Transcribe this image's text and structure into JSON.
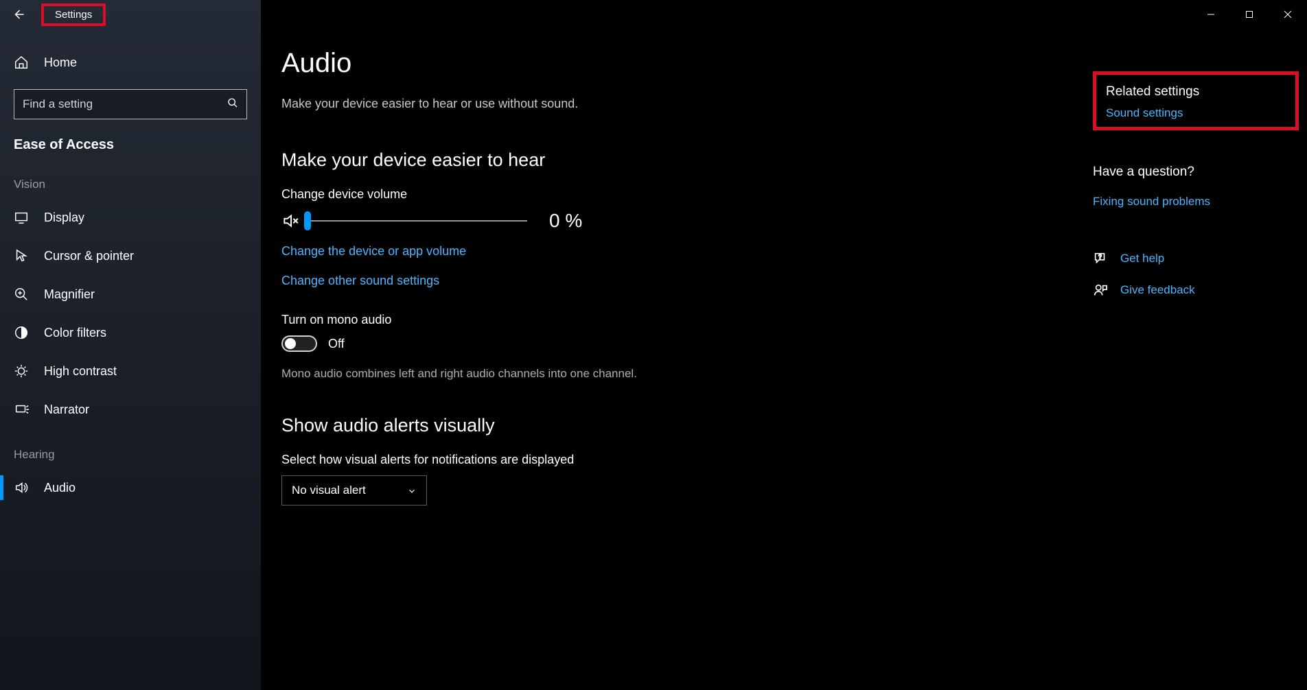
{
  "window": {
    "title": "Settings"
  },
  "sidebar": {
    "home": "Home",
    "search_placeholder": "Find a setting",
    "category": "Ease of Access",
    "groups": [
      {
        "label": "Vision",
        "items": [
          {
            "label": "Display"
          },
          {
            "label": "Cursor & pointer"
          },
          {
            "label": "Magnifier"
          },
          {
            "label": "Color filters"
          },
          {
            "label": "High contrast"
          },
          {
            "label": "Narrator"
          }
        ]
      },
      {
        "label": "Hearing",
        "items": [
          {
            "label": "Audio",
            "active": true
          }
        ]
      }
    ]
  },
  "main": {
    "title": "Audio",
    "subtitle": "Make your device easier to hear or use without sound.",
    "section_hear": "Make your device easier to hear",
    "volume_label": "Change device volume",
    "volume_value": "0 %",
    "volume_percent": 0,
    "link_device_volume": "Change the device or app volume",
    "link_other_sound": "Change other sound settings",
    "mono_label": "Turn on mono audio",
    "mono_toggle_state": "Off",
    "mono_desc": "Mono audio combines left and right audio channels into one channel.",
    "section_visual": "Show audio alerts visually",
    "visual_label": "Select how visual alerts for notifications are displayed",
    "visual_dropdown": "No visual alert"
  },
  "rail": {
    "related_heading": "Related settings",
    "related_link": "Sound settings",
    "question": "Have a question?",
    "question_link": "Fixing sound problems",
    "get_help": "Get help",
    "give_feedback": "Give feedback"
  }
}
